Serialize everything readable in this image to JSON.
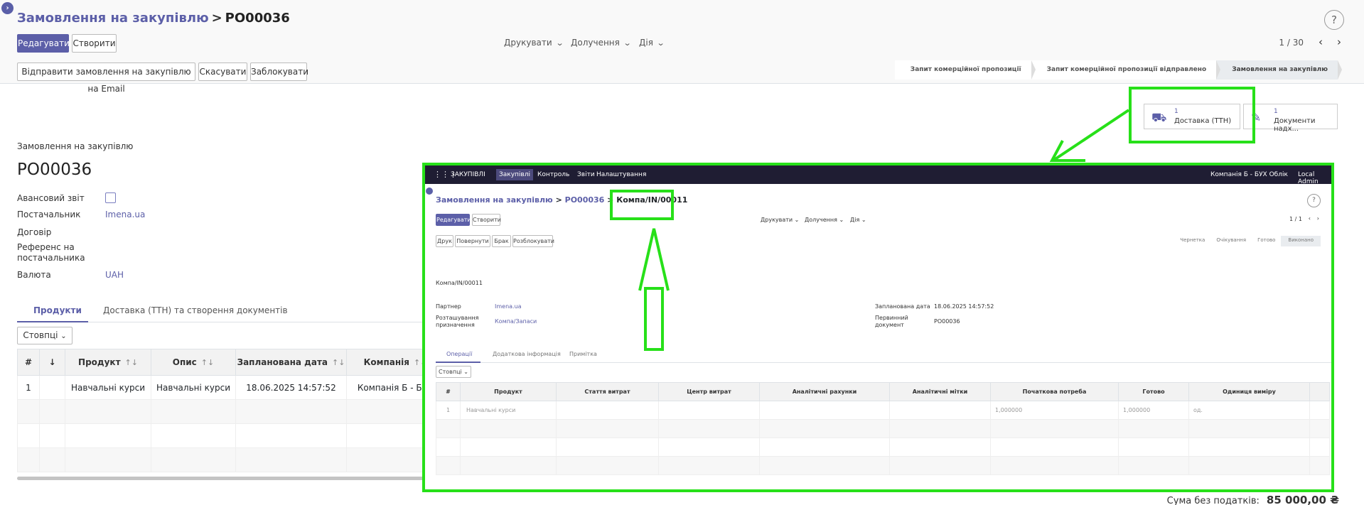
{
  "breadcrumb": {
    "parent": "Замовлення на закупівлю",
    "separator": ">",
    "current": "PO00036"
  },
  "help_label": "?",
  "toolbar": {
    "edit": "Редагувати",
    "create": "Створити",
    "print": "Друкувати",
    "attach": "Долучення",
    "action": "Дія",
    "pager": "1 / 30"
  },
  "actions": {
    "email": "Відправити замовлення на закупівлю на Email",
    "cancel": "Скасувати",
    "lock": "Заблокувати"
  },
  "stages": [
    "Запит комерційної пропозиції",
    "Запит комерційної пропозиції відправлено",
    "Замовлення на закупівлю"
  ],
  "active_stage_index": 2,
  "smart_buttons": [
    {
      "count": "1",
      "label": "Доставка (ТТН)",
      "icon": "truck-icon"
    },
    {
      "count": "1",
      "label": "Документи надх...",
      "icon": "edit-icon"
    }
  ],
  "form": {
    "doc_type": "Замовлення на закупівлю",
    "name": "PO00036",
    "advance_report_label": "Авансовий звіт",
    "advance_report_checked": false,
    "vendor_label": "Постачальник",
    "vendor_value": "Imena.ua",
    "contract_label": "Договір",
    "vendor_ref_label": "Референс на постачальника",
    "currency_label": "Валюта",
    "currency_value": "UAH"
  },
  "tabs": [
    "Продукти",
    "Доставка (ТТН) та створення документів"
  ],
  "columns_button": "Стовпці",
  "order_lines": {
    "headers": [
      "#",
      "↓",
      "Продукт",
      "Опис",
      "Запланована дата",
      "Компанія"
    ],
    "rows": [
      [
        "1",
        "",
        "Навчальні курси",
        "Навчальні курси",
        "18.06.2025 14:57:52",
        "Компанія Б - БУХ"
      ]
    ]
  },
  "total": {
    "label": "Сума без податків:",
    "value": "85 000,00 ₴"
  },
  "overlay": {
    "navbar": {
      "app": "ЗАКУПІВЛІ",
      "menus": [
        "Закупівлі",
        "Контроль",
        "Звіти",
        "Налаштування"
      ],
      "company": "Компанія Б - БУХ Облік",
      "user": "Local Admin"
    },
    "breadcrumb": {
      "parent": "Замовлення на закупівлю",
      "mid": "PO00036",
      "current": "Компа/IN/00011"
    },
    "toolbar": {
      "edit": "Редагувати",
      "create": "Створити",
      "print": "Друкувати",
      "attach": "Долучення",
      "action": "Дія",
      "pager": "1 / 1"
    },
    "actions": [
      "Друк",
      "Повернути",
      "Брак",
      "Розблокувати"
    ],
    "stages": [
      "Чернетка",
      "Очікування",
      "Готово",
      "Виконано"
    ],
    "doc_name": "Компа/IN/00011",
    "partner_label": "Партнер",
    "partner_value": "Imena.ua",
    "location_label": "Розташування призначення",
    "location_value": "Компа/Запаси",
    "scheduled_label": "Запланована дата",
    "scheduled_value": "18.06.2025 14:57:52",
    "origin_label": "Первинний документ",
    "origin_value": "PO00036",
    "tabs": [
      "Операції",
      "Додаткова інформація",
      "Примітка"
    ],
    "columns_button": "Стовпці",
    "table_headers": [
      "#",
      "Продукт",
      "Стаття витрат",
      "Центр витрат",
      "Аналітичні рахунки",
      "Аналітичні мітки",
      "Початкова потреба",
      "Готово",
      "Одиниця виміру"
    ],
    "rows": [
      [
        "1",
        "Навчальні курси",
        "",
        "",
        "",
        "",
        "1,000000",
        "1,000000",
        "од."
      ]
    ]
  },
  "annotation_color": "#27e019"
}
